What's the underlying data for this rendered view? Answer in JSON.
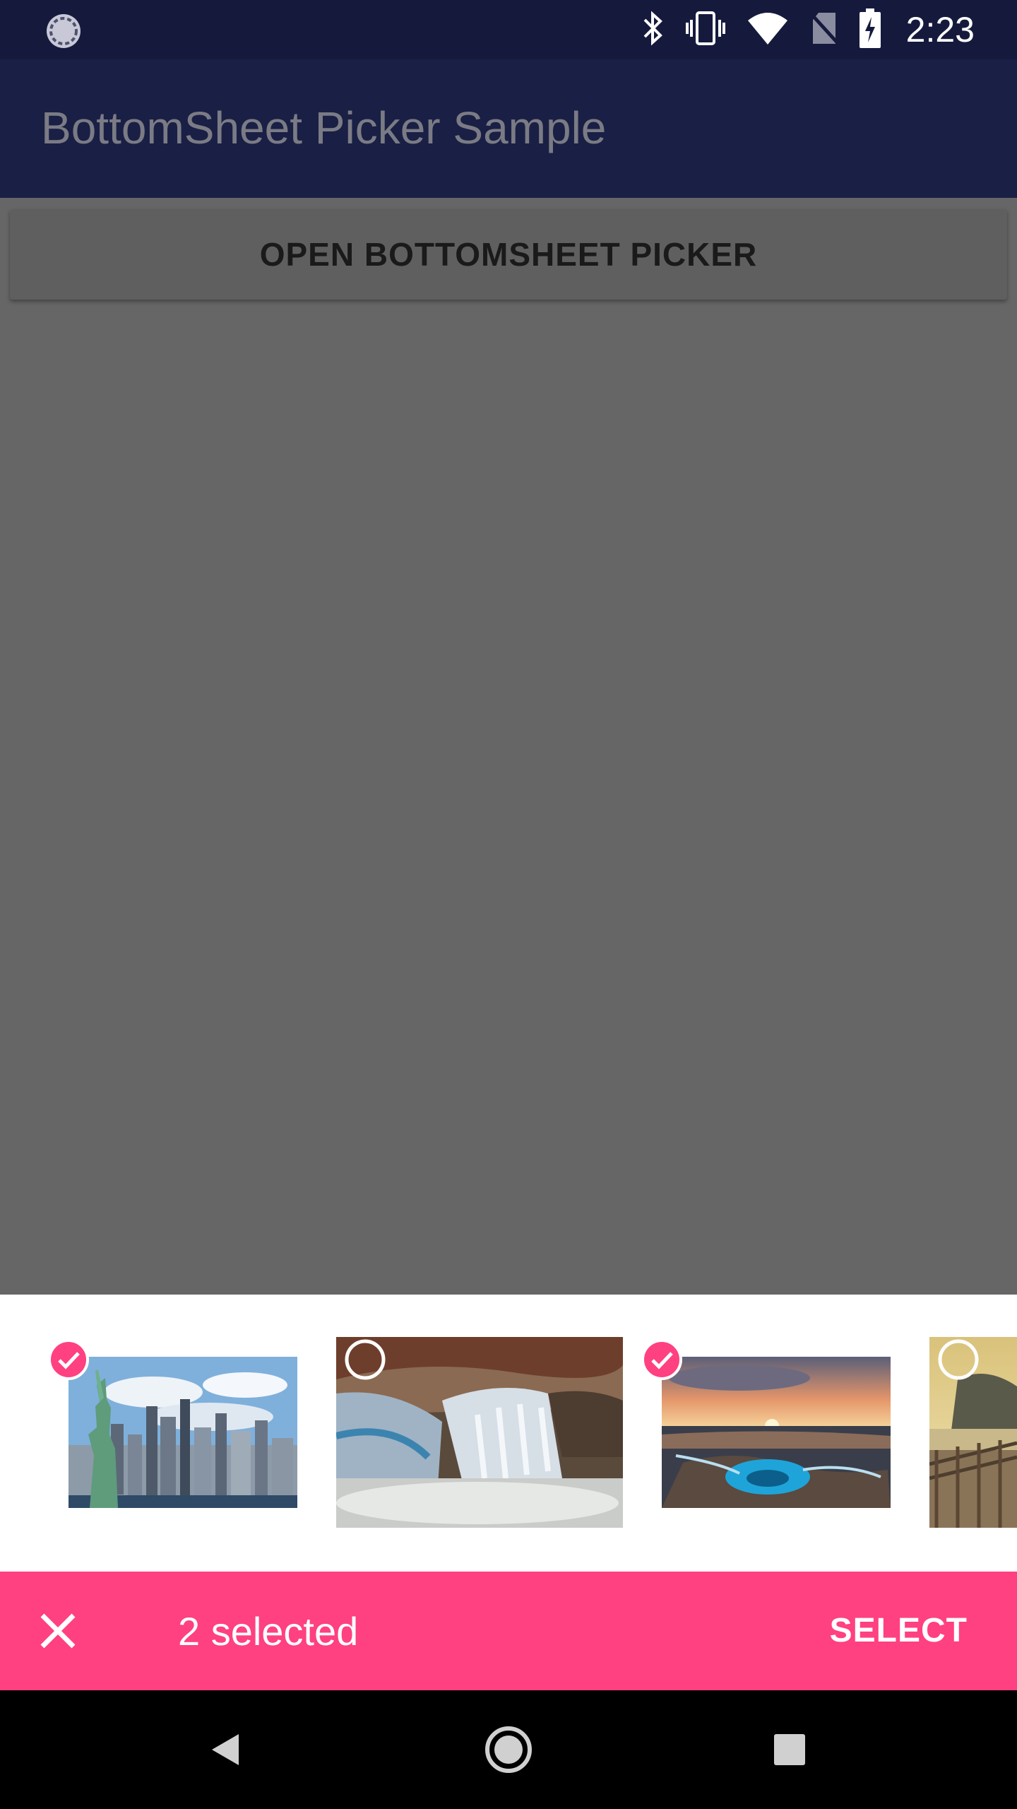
{
  "status_bar": {
    "time": "2:23",
    "icons": [
      "sync-icon",
      "bluetooth-icon",
      "vibrate-icon",
      "wifi-icon",
      "no-sim-icon",
      "battery-charging-icon"
    ]
  },
  "app_bar": {
    "title": "BottomSheet Picker Sample"
  },
  "main": {
    "open_button_label": "OPEN BOTTOMSHEET PICKER"
  },
  "picker": {
    "images": [
      {
        "subject": "statue-of-liberty-skyline",
        "selected": true
      },
      {
        "subject": "waterfall",
        "selected": false
      },
      {
        "subject": "sunset-rocky-shore",
        "selected": true
      },
      {
        "subject": "boardwalk-lake",
        "selected": false
      }
    ]
  },
  "selection_bar": {
    "count_label": "2 selected",
    "select_label": "SELECT"
  },
  "nav_bar": {
    "icons": [
      "back-icon",
      "home-icon",
      "recents-icon"
    ]
  },
  "colors": {
    "status_bar": "#151a3d",
    "app_bar": "#1a1f45",
    "scrim": "#666666",
    "accent": "#ff4081"
  }
}
